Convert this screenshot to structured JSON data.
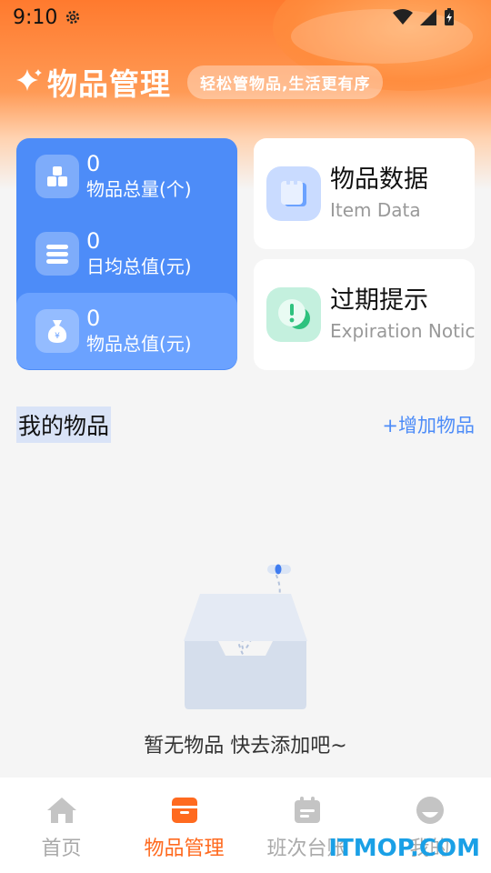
{
  "status": {
    "time": "9:10"
  },
  "header": {
    "title": "物品管理",
    "slogan": "轻松管物品,生活更有序"
  },
  "stats": [
    {
      "value": "0",
      "label": "物品总量(个)",
      "icon": "boxes-icon"
    },
    {
      "value": "0",
      "label": "日均总值(元)",
      "icon": "stack-icon"
    },
    {
      "value": "0",
      "label": "物品总值(元)",
      "icon": "money-bag-icon"
    }
  ],
  "features": [
    {
      "title": "物品数据",
      "subtitle": "Item Data"
    },
    {
      "title": "过期提示",
      "subtitle": "Expiration Notice"
    }
  ],
  "section": {
    "title": "我的物品",
    "add_label": "+增加物品"
  },
  "empty": {
    "text": "暂无物品 快去添加吧~"
  },
  "tabs": [
    {
      "label": "首页"
    },
    {
      "label": "物品管理"
    },
    {
      "label": "班次台账"
    },
    {
      "label": "我的"
    }
  ],
  "watermark": "ITMOP.COM",
  "colors": {
    "accent": "#ff6a1f",
    "blue": "#4d8cf8",
    "tab_inactive": "#aaaaaa"
  }
}
